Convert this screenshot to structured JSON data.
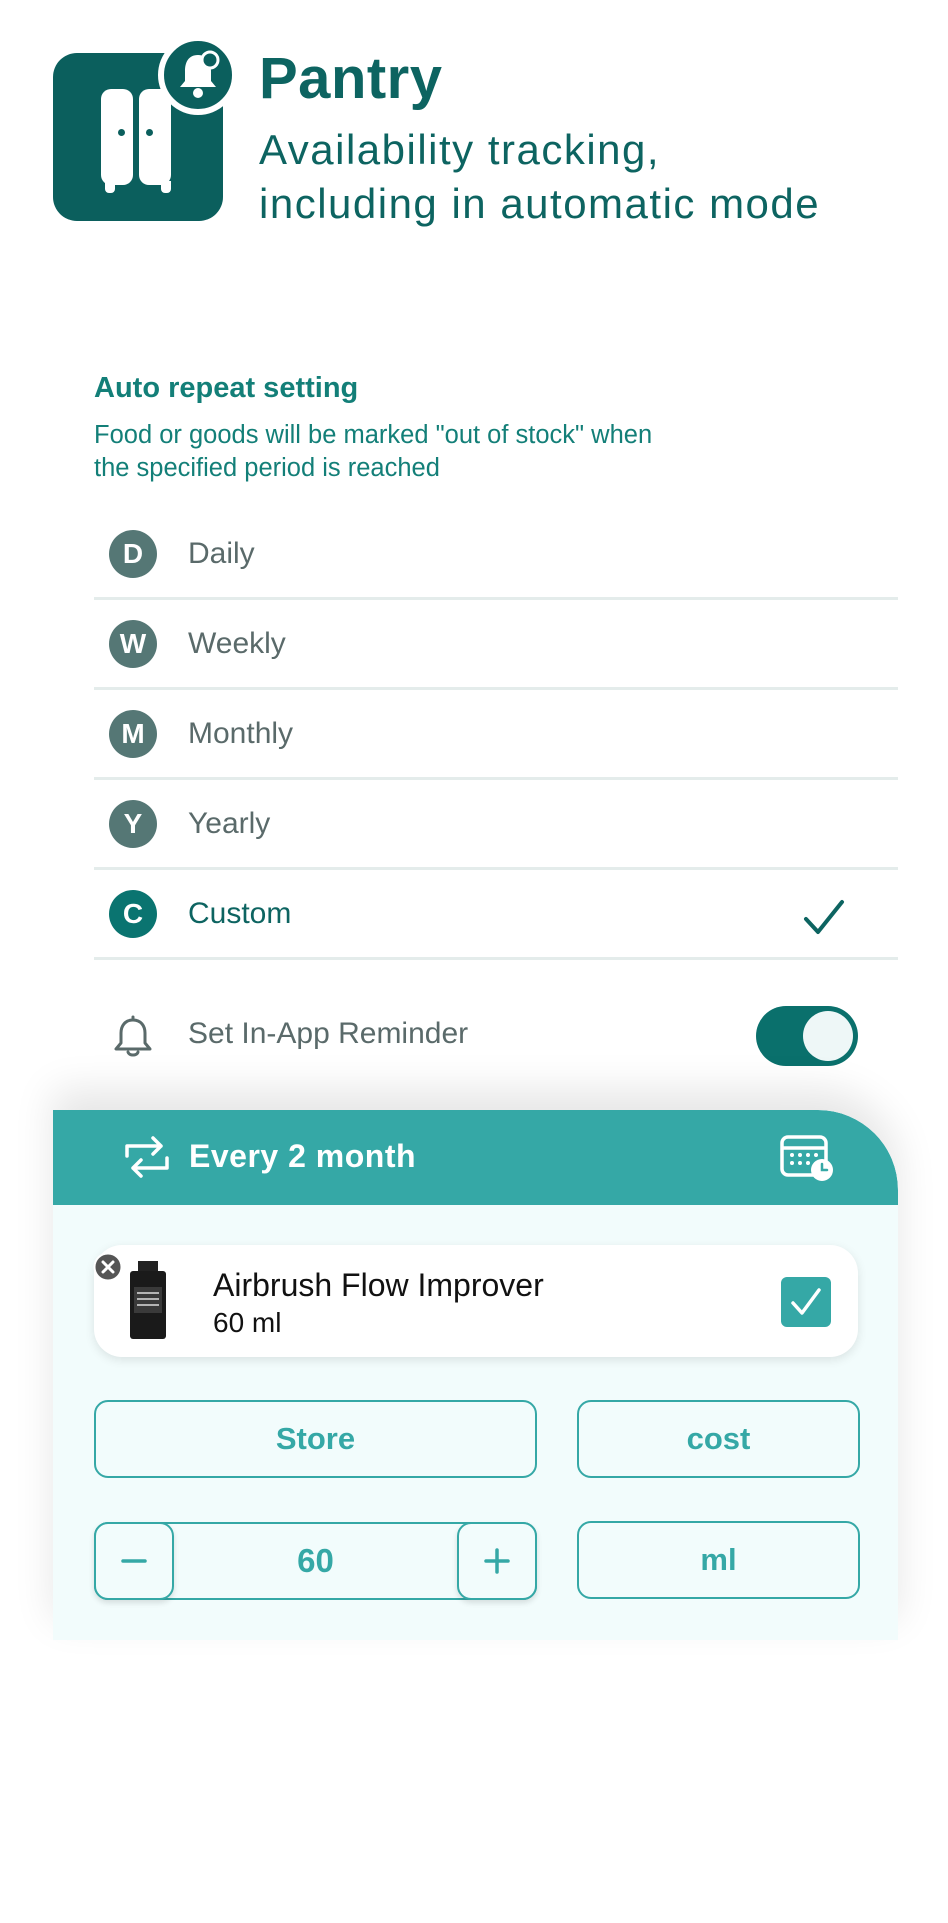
{
  "header": {
    "title": "Pantry",
    "subtitle": "Availability tracking,\nincluding in automatic mode"
  },
  "settings": {
    "title": "Auto repeat setting",
    "description": "Food or goods will be marked \"out of stock\" when\nthe specified period is reached",
    "options": [
      {
        "letter": "D",
        "label": "Daily",
        "selected": false
      },
      {
        "letter": "W",
        "label": "Weekly",
        "selected": false
      },
      {
        "letter": "M",
        "label": "Monthly",
        "selected": false
      },
      {
        "letter": "Y",
        "label": "Yearly",
        "selected": false
      },
      {
        "letter": "C",
        "label": "Custom",
        "selected": true
      }
    ],
    "reminder": {
      "label": "Set In-App Reminder",
      "enabled": true
    }
  },
  "card": {
    "title": "Every 2 month",
    "item": {
      "name": "Airbrush Flow Improver",
      "quantity": "60 ml",
      "checked": true
    },
    "store_label": "Store",
    "cost_label": "cost",
    "amount_value": "60",
    "unit_label": "ml",
    "minus_label": "−",
    "plus_label": "+"
  },
  "colors": {
    "primary": "#0b5f5d",
    "accent": "#35a8a6",
    "badge": "#557775",
    "card_bg": "#f2fcfc"
  }
}
